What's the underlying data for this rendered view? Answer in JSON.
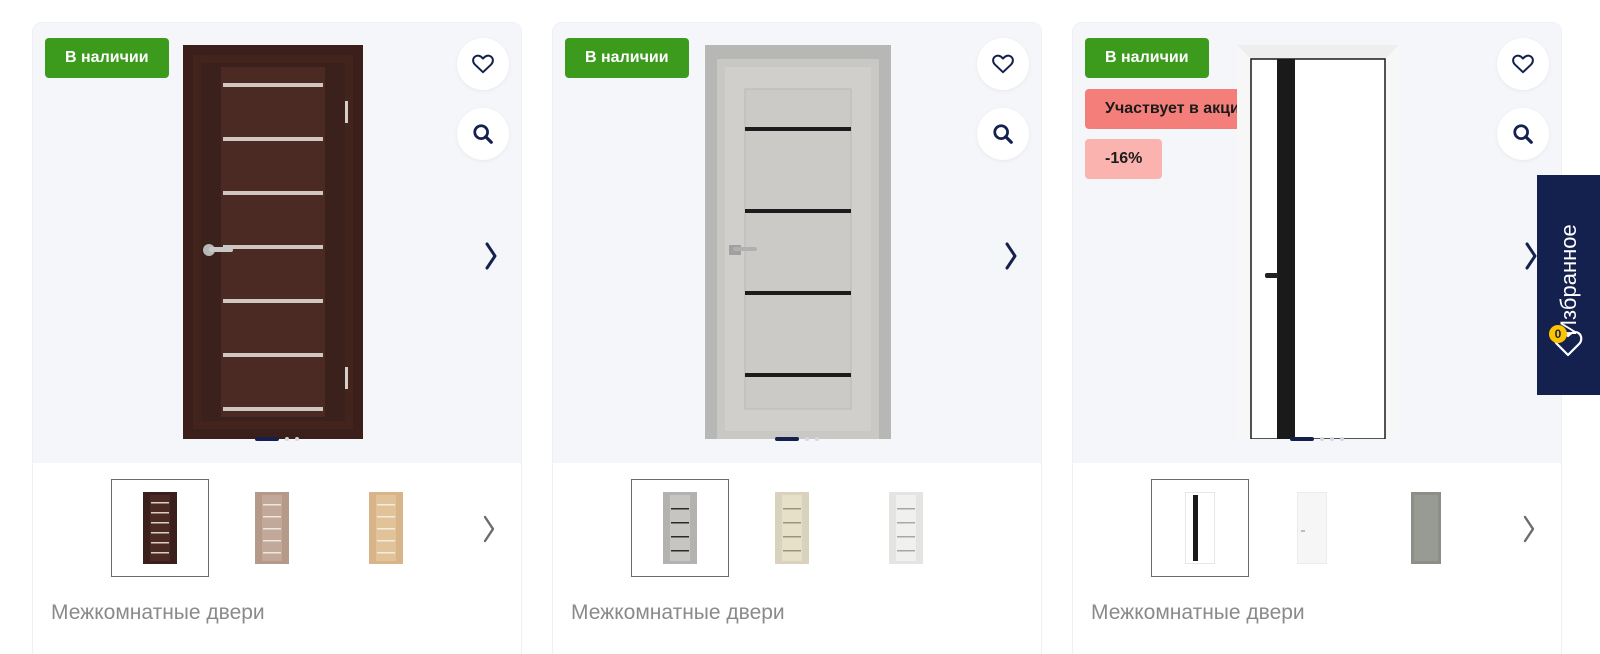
{
  "colors": {
    "stock_badge": "#3c9a1d",
    "promo_badge": "#f47f7a",
    "discount_badge": "#fbb3b0",
    "brand_navy": "#14214f",
    "counter_badge": "#ffc400"
  },
  "icons": {
    "favorite": "heart-icon",
    "zoom": "magnifier-icon",
    "next": "chevron-right-icon"
  },
  "favorites_tab": {
    "label": "Избранное",
    "count": "0"
  },
  "products": [
    {
      "stock_badge": "В наличии",
      "promo_badge": null,
      "discount_badge": null,
      "category": "Межкомнатные двери",
      "door_color": "wenge",
      "image_count": 3,
      "thumbnails": [
        "wenge",
        "bleached-oak",
        "light-oak"
      ]
    },
    {
      "stock_badge": "В наличии",
      "promo_badge": null,
      "discount_badge": null,
      "category": "Межкомнатные двери",
      "door_color": "concrete-grey",
      "image_count": 3,
      "thumbnails": [
        "concrete-grey",
        "cream",
        "white"
      ]
    },
    {
      "stock_badge": "В наличии",
      "promo_badge": "Участвует в акции",
      "discount_badge": "-16%",
      "category": "Межкомнатные двери",
      "door_color": "white",
      "image_count": 4,
      "thumbnails": [
        "white-black-glass",
        "white",
        "grey"
      ]
    }
  ]
}
